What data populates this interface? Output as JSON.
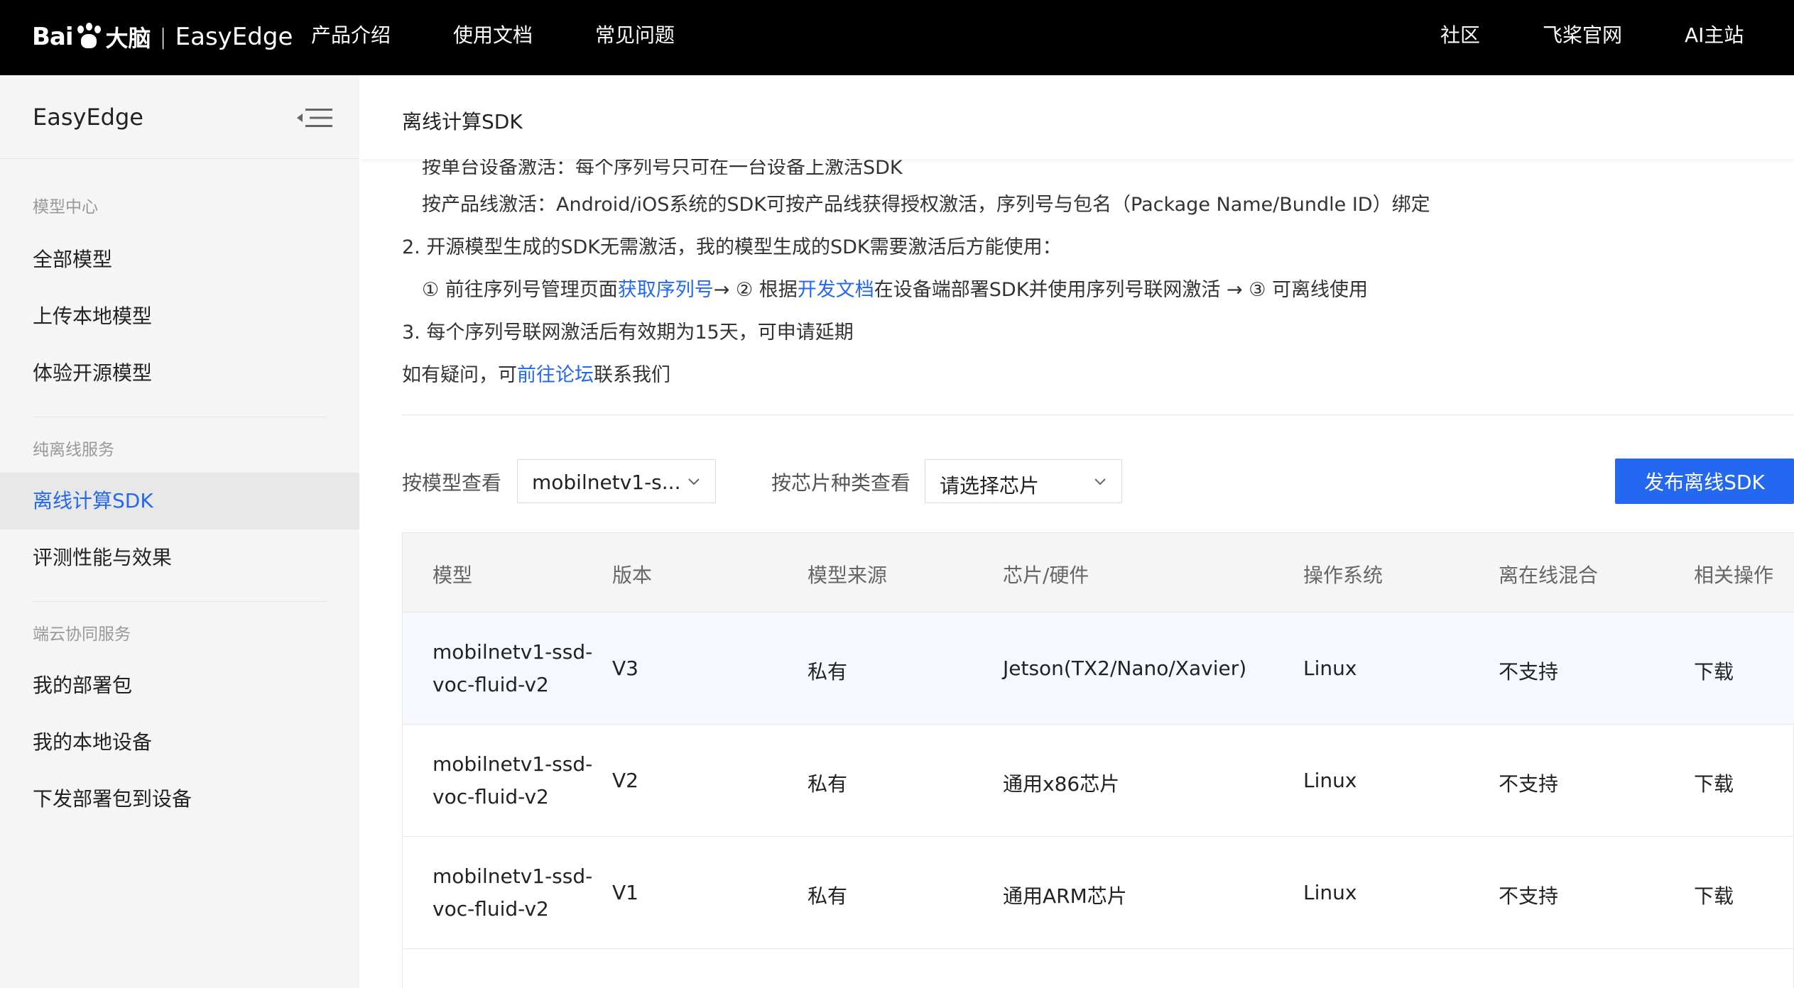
{
  "topbar": {
    "logo_bai": "Bai",
    "logo_du": "大脑",
    "logo_sep": "|",
    "logo_product": "EasyEdge",
    "nav_left": [
      "产品介绍",
      "使用文档",
      "常见问题"
    ],
    "nav_right": [
      "社区",
      "飞桨官网",
      "AI主站"
    ]
  },
  "sidebar": {
    "title": "EasyEdge",
    "groups": [
      {
        "label": "模型中心",
        "items": [
          "全部模型",
          "上传本地模型",
          "体验开源模型"
        ]
      },
      {
        "label": "纯离线服务",
        "items": [
          "离线计算SDK",
          "评测性能与效果"
        ]
      },
      {
        "label": "端云协同服务",
        "items": [
          "我的部署包",
          "我的本地设备",
          "下发部署包到设备"
        ]
      }
    ],
    "active": "离线计算SDK"
  },
  "main": {
    "breadcrumb": "离线计算SDK",
    "notes": {
      "cut_line": "按单台设备激活：每个序列号只可在一台设备上激活SDK",
      "line1": "按产品线激活：Android/iOS系统的SDK可按产品线获得授权激活，序列号与包名（Package Name/Bundle ID）绑定",
      "line2": "2. 开源模型生成的SDK无需激活，我的模型生成的SDK需要激活后方能使用：",
      "line3_a": "① 前往序列号管理页面",
      "line3_link1": "获取序列号",
      "line3_b": "→ ② 根据",
      "line3_link2": "开发文档",
      "line3_c": "在设备端部署SDK并使用序列号联网激活 → ③ 可离线使用",
      "line4": "3. 每个序列号联网激活后有效期为15天，可申请延期",
      "line5_a": "如有疑问，可",
      "line5_link": "前往论坛",
      "line5_b": "联系我们"
    },
    "filters": {
      "model_label": "按模型查看",
      "model_value": "mobilnetv1-s...",
      "chip_label": "按芯片种类查看",
      "chip_value": "请选择芯片"
    },
    "publish_button": "发布离线SDK",
    "table": {
      "columns": [
        "模型",
        "版本",
        "模型来源",
        "芯片/硬件",
        "操作系统",
        "离在线混合",
        "相关操作"
      ],
      "rows": [
        {
          "model_l1": "mobilnetv1-ssd-",
          "model_l2": "voc-fluid-v2",
          "version": "V3",
          "source": "私有",
          "chip": "Jetson(TX2/Nano/Xavier)",
          "os": "Linux",
          "hybrid": "不支持",
          "action": "下载"
        },
        {
          "model_l1": "mobilnetv1-ssd-",
          "model_l2": "voc-fluid-v2",
          "version": "V2",
          "source": "私有",
          "chip": "通用x86芯片",
          "os": "Linux",
          "hybrid": "不支持",
          "action": "下载"
        },
        {
          "model_l1": "mobilnetv1-ssd-",
          "model_l2": "voc-fluid-v2",
          "version": "V1",
          "source": "私有",
          "chip": "通用ARM芯片",
          "os": "Linux",
          "hybrid": "不支持",
          "action": "下载"
        }
      ]
    }
  },
  "colors": {
    "topbar_bg": "#000000",
    "accent": "#2468f2",
    "sidebar_bg": "#f5f5f5",
    "active_bg": "#e8e8e8"
  }
}
